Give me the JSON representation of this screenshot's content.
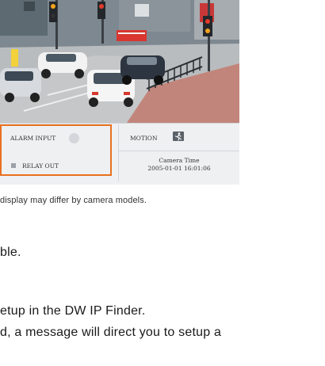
{
  "panel": {
    "alarm_input_label": "ALARM INPUT",
    "relay_out_label": "RELAY OUT",
    "motion_label": "MOTION",
    "camera_time_label": "Camera Time",
    "camera_time_value": "2005-01-01 16:01:06"
  },
  "caption": "display may differ by camera models.",
  "body_lines": [
    "ble.",
    "etup in the DW IP Finder.",
    "d, a message will direct you to setup a"
  ],
  "colors": {
    "highlight_border": "#e8701e"
  }
}
